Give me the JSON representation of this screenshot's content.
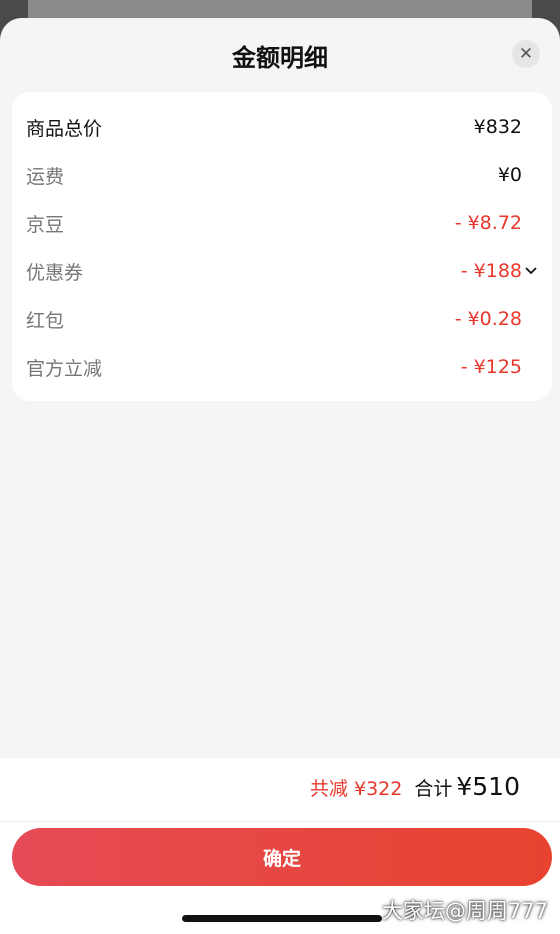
{
  "sheet": {
    "title": "金额明细",
    "close_icon": "close-icon"
  },
  "items": [
    {
      "label": "商品总价",
      "value": "¥832"
    },
    {
      "label": "运费",
      "value": "¥0"
    },
    {
      "label": "京豆",
      "value": "- ¥8.72"
    },
    {
      "label": "优惠券",
      "value": "- ¥188",
      "icon": "chevron-down-icon"
    },
    {
      "label": "红包",
      "value": "- ¥0.28"
    },
    {
      "label": "官方立减",
      "value": "- ¥125"
    }
  ],
  "summary": {
    "saving": "共减 ¥322",
    "total_label": "合计",
    "total_value": "¥510"
  },
  "confirm_label": "确定",
  "watermark": "大家坛@周周777",
  "colors": {
    "accent_red": "#e8382d",
    "sheet_background": "#f5f5f5",
    "card_background": "#ffffff"
  }
}
